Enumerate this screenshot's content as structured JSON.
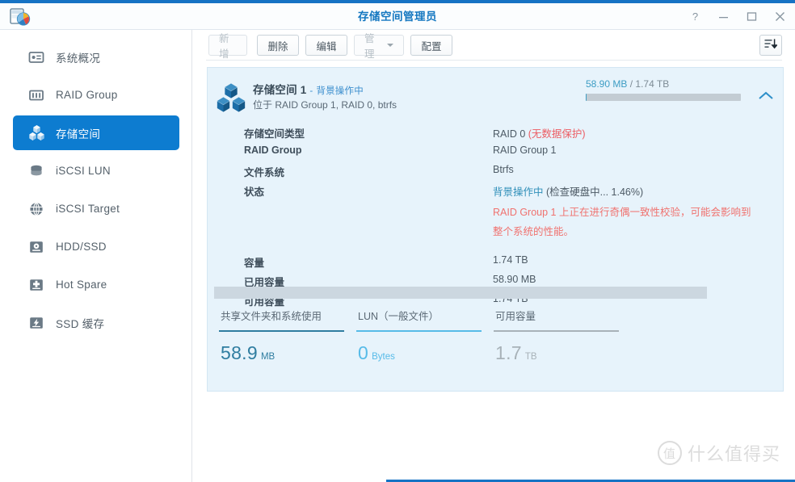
{
  "window": {
    "title": "存储空间管理员",
    "app_icon": "storage-manager-icon",
    "controls": [
      {
        "name": "help-button",
        "glyph": "?"
      },
      {
        "name": "minimize-button",
        "glyph": "–"
      },
      {
        "name": "maximize-button",
        "glyph": "□"
      },
      {
        "name": "close-button",
        "glyph": "✕"
      }
    ]
  },
  "sidebar": {
    "items": [
      {
        "label": "系统概况",
        "icon": "overview-icon",
        "active": false
      },
      {
        "label": "RAID Group",
        "icon": "raid-group-icon",
        "active": false
      },
      {
        "label": "存储空间",
        "icon": "storage-volume-icon",
        "active": true
      },
      {
        "label": "iSCSI LUN",
        "icon": "iscsi-lun-icon",
        "active": false
      },
      {
        "label": "iSCSI Target",
        "icon": "iscsi-target-icon",
        "active": false
      },
      {
        "label": "HDD/SSD",
        "icon": "hdd-ssd-icon",
        "active": false
      },
      {
        "label": "Hot Spare",
        "icon": "hot-spare-icon",
        "active": false
      },
      {
        "label": "SSD 缓存",
        "icon": "ssd-cache-icon",
        "active": false
      }
    ]
  },
  "toolbar": {
    "create_label": "新增",
    "delete_label": "删除",
    "edit_label": "编辑",
    "manage_label": "管理",
    "configure_label": "配置",
    "sort_icon": "sort-list-icon"
  },
  "card": {
    "icon": "storage-volume-cubes-icon",
    "title": "存储空间 1",
    "title_separator": "-",
    "title_status": "背景操作中",
    "subtitle": "位于 RAID Group 1, RAID 0, btrfs",
    "capacity_used": "58.90 MB",
    "capacity_sep": "/",
    "capacity_total": "1.74 TB",
    "capacity_percent": 0.003,
    "collapse_icon": "chevron-up-icon",
    "details": [
      {
        "key": "存储空间类型",
        "value": "RAID 0 ",
        "value_red": "(无数据保护)"
      },
      {
        "key": "RAID Group",
        "value": "RAID Group 1"
      },
      {
        "key": "文件系统",
        "value": "Btrfs"
      },
      {
        "key": "状态",
        "value_teal": "背景操作中 ",
        "value": "(检查硬盘中... 1.46%)"
      }
    ],
    "warning": "RAID Group 1 上正在进行奇偶一致性校验，可能会影响到整个系统的性能。",
    "details2": [
      {
        "key": "容量",
        "value": "1.74 TB"
      },
      {
        "key": "已用容量",
        "value": "58.90 MB"
      },
      {
        "key": "可用容量",
        "value": "1.74 TB"
      }
    ],
    "legend": [
      {
        "name": "共享文件夹和系统使用",
        "value": "58.9",
        "unit": "MB",
        "color": "#2f7da0"
      },
      {
        "name": "LUN（一般文件）",
        "value": "0",
        "unit": "Bytes",
        "color": "#57bbe8"
      },
      {
        "name": "可用容量",
        "value": "1.7",
        "unit": "TB",
        "color": "#a8b2b8"
      }
    ]
  },
  "watermark": {
    "badge": "值",
    "text": "什么值得买"
  }
}
